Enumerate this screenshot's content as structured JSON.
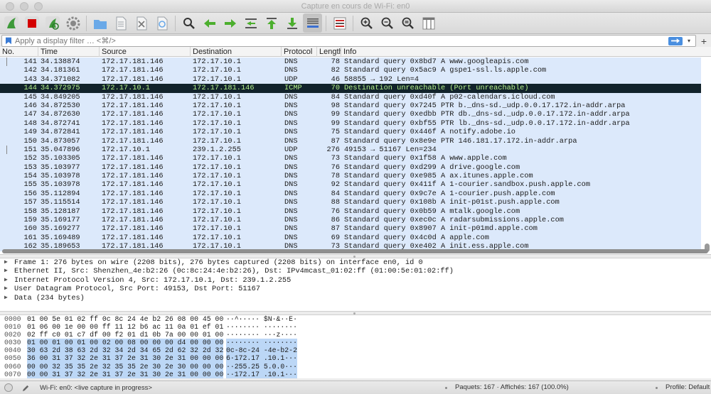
{
  "window": {
    "title": "Capture en cours de Wi-Fi: en0"
  },
  "toolbar": {
    "buttons": [
      {
        "icon": "shark-fin-start-icon",
        "color": "#3e9a3a"
      },
      {
        "icon": "stop-icon",
        "color": "#d40000"
      },
      {
        "icon": "restart-icon",
        "color": "#3e9a3a"
      },
      {
        "icon": "gear-icon",
        "color": "#888888"
      },
      {
        "icon": "folder-open-icon",
        "color": "#6aa9e8"
      },
      {
        "icon": "file-icon",
        "color": "#9aa0a6"
      },
      {
        "icon": "close-file-icon",
        "color": "#9aa0a6"
      },
      {
        "icon": "reload-file-icon",
        "color": "#9aa0a6"
      },
      {
        "icon": "search-icon",
        "color": "#333333"
      },
      {
        "icon": "arrow-left-icon",
        "color": "#4caf2e"
      },
      {
        "icon": "arrow-right-icon",
        "color": "#4caf2e"
      },
      {
        "icon": "go-to-packet-icon",
        "color": "#4caf2e"
      },
      {
        "icon": "first-packet-icon",
        "color": "#4caf2e"
      },
      {
        "icon": "last-packet-icon",
        "color": "#4caf2e"
      },
      {
        "icon": "autoscroll-icon",
        "color": "#3a6fd1"
      },
      {
        "icon": "colorize-icon",
        "color": "#cc2222"
      },
      {
        "icon": "zoom-in-icon",
        "color": "#333333"
      },
      {
        "icon": "zoom-out-icon",
        "color": "#333333"
      },
      {
        "icon": "zoom-reset-icon",
        "color": "#333333"
      },
      {
        "icon": "resize-columns-icon",
        "color": "#555555"
      }
    ]
  },
  "filter": {
    "placeholder": "Apply a display filter … <⌘/>",
    "value": ""
  },
  "packet_list": {
    "columns": [
      "No.",
      "Time",
      "Source",
      "Destination",
      "Protocol",
      "Length",
      "Info"
    ],
    "selected_no": "144",
    "rows": [
      {
        "no": "141",
        "time": "34.138874",
        "src": "172.17.181.146",
        "dst": "172.17.10.1",
        "proto": "DNS",
        "len": "78",
        "info": "Standard query 0x8bd7 A www.googleapis.com"
      },
      {
        "no": "142",
        "time": "34.181361",
        "src": "172.17.181.146",
        "dst": "172.17.10.1",
        "proto": "DNS",
        "len": "82",
        "info": "Standard query 0x5ac9 A gspe1-ssl.ls.apple.com"
      },
      {
        "no": "143",
        "time": "34.371082",
        "src": "172.17.181.146",
        "dst": "172.17.10.1",
        "proto": "UDP",
        "len": "46",
        "info": "58855 → 192 Len=4"
      },
      {
        "no": "144",
        "time": "34.372975",
        "src": "172.17.10.1",
        "dst": "172.17.181.146",
        "proto": "ICMP",
        "len": "70",
        "info": "Destination unreachable (Port unreachable)"
      },
      {
        "no": "145",
        "time": "34.849205",
        "src": "172.17.181.146",
        "dst": "172.17.10.1",
        "proto": "DNS",
        "len": "84",
        "info": "Standard query 0xd40f A p02-calendars.icloud.com"
      },
      {
        "no": "146",
        "time": "34.872530",
        "src": "172.17.181.146",
        "dst": "172.17.10.1",
        "proto": "DNS",
        "len": "98",
        "info": "Standard query 0x7245 PTR b._dns-sd._udp.0.0.17.172.in-addr.arpa"
      },
      {
        "no": "147",
        "time": "34.872630",
        "src": "172.17.181.146",
        "dst": "172.17.10.1",
        "proto": "DNS",
        "len": "99",
        "info": "Standard query 0xedbb PTR db._dns-sd._udp.0.0.17.172.in-addr.arpa"
      },
      {
        "no": "148",
        "time": "34.872741",
        "src": "172.17.181.146",
        "dst": "172.17.10.1",
        "proto": "DNS",
        "len": "99",
        "info": "Standard query 0xbf55 PTR lb._dns-sd._udp.0.0.17.172.in-addr.arpa"
      },
      {
        "no": "149",
        "time": "34.872841",
        "src": "172.17.181.146",
        "dst": "172.17.10.1",
        "proto": "DNS",
        "len": "75",
        "info": "Standard query 0x446f A notify.adobe.io"
      },
      {
        "no": "150",
        "time": "34.873057",
        "src": "172.17.181.146",
        "dst": "172.17.10.1",
        "proto": "DNS",
        "len": "87",
        "info": "Standard query 0x8e9e PTR 146.181.17.172.in-addr.arpa"
      },
      {
        "no": "151",
        "time": "35.047896",
        "src": "172.17.10.1",
        "dst": "239.1.2.255",
        "proto": "UDP",
        "len": "276",
        "info": "49153 → 51167 Len=234"
      },
      {
        "no": "152",
        "time": "35.103305",
        "src": "172.17.181.146",
        "dst": "172.17.10.1",
        "proto": "DNS",
        "len": "73",
        "info": "Standard query 0x1f58 A www.apple.com"
      },
      {
        "no": "153",
        "time": "35.103977",
        "src": "172.17.181.146",
        "dst": "172.17.10.1",
        "proto": "DNS",
        "len": "76",
        "info": "Standard query 0xd299 A drive.google.com"
      },
      {
        "no": "154",
        "time": "35.103978",
        "src": "172.17.181.146",
        "dst": "172.17.10.1",
        "proto": "DNS",
        "len": "78",
        "info": "Standard query 0xe985 A ax.itunes.apple.com"
      },
      {
        "no": "155",
        "time": "35.103978",
        "src": "172.17.181.146",
        "dst": "172.17.10.1",
        "proto": "DNS",
        "len": "92",
        "info": "Standard query 0x411f A 1-courier.sandbox.push.apple.com"
      },
      {
        "no": "156",
        "time": "35.112894",
        "src": "172.17.181.146",
        "dst": "172.17.10.1",
        "proto": "DNS",
        "len": "84",
        "info": "Standard query 0x9c7e A 1-courier.push.apple.com"
      },
      {
        "no": "157",
        "time": "35.115514",
        "src": "172.17.181.146",
        "dst": "172.17.10.1",
        "proto": "DNS",
        "len": "88",
        "info": "Standard query 0x108b A init-p01st.push.apple.com"
      },
      {
        "no": "158",
        "time": "35.128187",
        "src": "172.17.181.146",
        "dst": "172.17.10.1",
        "proto": "DNS",
        "len": "76",
        "info": "Standard query 0x0b59 A mtalk.google.com"
      },
      {
        "no": "159",
        "time": "35.169177",
        "src": "172.17.181.146",
        "dst": "172.17.10.1",
        "proto": "DNS",
        "len": "86",
        "info": "Standard query 0xec0c A radarsubmissions.apple.com"
      },
      {
        "no": "160",
        "time": "35.169277",
        "src": "172.17.181.146",
        "dst": "172.17.10.1",
        "proto": "DNS",
        "len": "87",
        "info": "Standard query 0x8907 A init-p01md.apple.com"
      },
      {
        "no": "161",
        "time": "35.169489",
        "src": "172.17.181.146",
        "dst": "172.17.10.1",
        "proto": "DNS",
        "len": "69",
        "info": "Standard query 0x4c0d A apple.com"
      },
      {
        "no": "162",
        "time": "35.189653",
        "src": "172.17.181.146",
        "dst": "172.17.10.1",
        "proto": "DNS",
        "len": "73",
        "info": "Standard query 0xe402 A init.ess.apple.com"
      }
    ]
  },
  "details": [
    "Frame 1: 276 bytes on wire (2208 bits), 276 bytes captured (2208 bits) on interface en0, id 0",
    "Ethernet II, Src: Shenzhen_4e:b2:26 (0c:8c:24:4e:b2:26), Dst: IPv4mcast_01:02:ff (01:00:5e:01:02:ff)",
    "Internet Protocol Version 4, Src: 172.17.10.1, Dst: 239.1.2.255",
    "User Datagram Protocol, Src Port: 49153, Dst Port: 51167",
    "Data (234 bytes)"
  ],
  "bytes": [
    {
      "off": "0000",
      "hex": "01 00 5e 01 02 ff 0c 8c  24 4e b2 26 08 00 45 00",
      "ascii": "··^·····  $N·&··E·"
    },
    {
      "off": "0010",
      "hex": "01 06 00 1e 00 00 ff 11  12 b6 ac 11 0a 01 ef 01",
      "ascii": "········  ········"
    },
    {
      "off": "0020",
      "hex": "02 ff c0 01 c7 df 00 f2  01 d1 0b 7a 00 00 01 00",
      "ascii": "········  ···z····"
    },
    {
      "off": "0030",
      "hex": "01 00 01 00 01 00 02 00  08 00 00 00 d4 00 00 00",
      "ascii": "········  ········"
    },
    {
      "off": "0040",
      "hex": "30 63 2d 38 63 2d 32 34  2d 34 65 2d 62 32 2d 32",
      "ascii": "0c-8c-24  -4e-b2-2"
    },
    {
      "off": "0050",
      "hex": "36 00 31 37 32 2e 31 37  2e 31 30 2e 31 00 00 00",
      "ascii": "6·172.17  .10.1···"
    },
    {
      "off": "0060",
      "hex": "00 00 32 35 35 2e 32 35  35 2e 30 2e 30 00 00 00",
      "ascii": "··255.25  5.0.0···"
    },
    {
      "off": "0070",
      "hex": "00 00 31 37 32 2e 31 37  2e 31 30 2e 31 00 00 00",
      "ascii": "··172.17  .10.1···"
    }
  ],
  "status": {
    "capture": "Wi-Fi: en0: <live capture in progress>",
    "packets": "Paquets: 167 · Affichés: 167 (100.0%)",
    "profile": "Profile: Default"
  }
}
